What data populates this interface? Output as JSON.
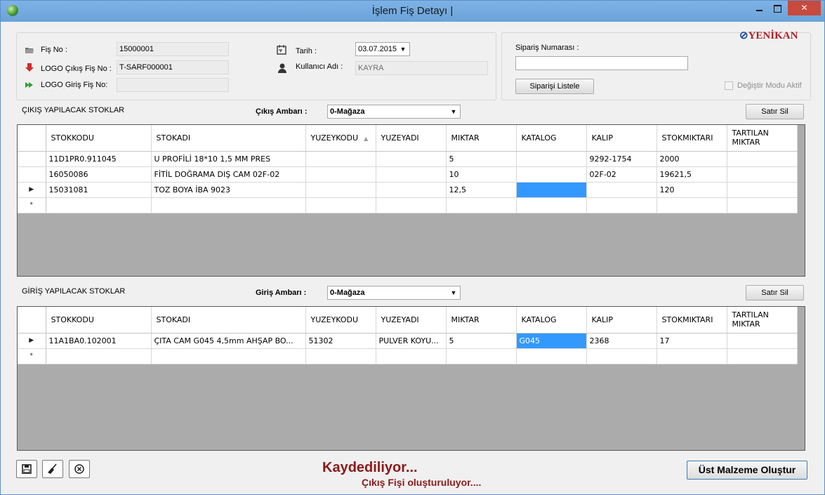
{
  "window": {
    "title": "İşlem Fiş Detayı |"
  },
  "header": {
    "fis_no_label": "Fiş No :",
    "fis_no_value": "15000001",
    "logo_cikis_label": "LOGO Çıkış Fiş No :",
    "logo_cikis_value": "T-SARF000001",
    "logo_giris_label": "LOGO Giriş Fiş No:",
    "logo_giris_value": "",
    "tarih_label": "Tarih :",
    "tarih_value": "03.07.2015",
    "kullanici_label": "Kullanıcı Adı :",
    "kullanici_value": "KAYRA"
  },
  "order": {
    "label": "Sipariş Numarası :",
    "input_value": "",
    "list_button": "Siparişi Listele",
    "logo_brand": "YENİKAN",
    "edit_mode_label": "Değiştir Modu Aktif"
  },
  "cikis": {
    "section_title": "ÇIKIŞ YAPILACAK STOKLAR",
    "ambar_label": "Çıkış Ambarı :",
    "ambar_value": "0-Mağaza",
    "delete_button": "Satır Sil",
    "columns": [
      "STOKKODU",
      "STOKADI",
      "YUZEYKODU",
      "YUZEYADI",
      "MIKTAR",
      "KATALOG",
      "KALIP",
      "STOKMIKTARI",
      "TARTILAN MIKTAR"
    ],
    "rows": [
      [
        "11D1PR0.911045",
        "U PROFİLİ 18*10 1,5 MM PRES",
        "",
        "",
        "5",
        "",
        "9292-1754",
        "2000",
        ""
      ],
      [
        "16050086",
        "FİTİL DOĞRAMA DIŞ CAM 02F-02",
        "",
        "",
        "10",
        "",
        "02F-02",
        "19621,5",
        ""
      ],
      [
        "15031081",
        "TOZ BOYA İBA 9023",
        "",
        "",
        "12,5",
        "",
        "",
        "120",
        ""
      ]
    ]
  },
  "giris": {
    "section_title": "GİRİŞ YAPILACAK STOKLAR",
    "ambar_label": "Giriş Ambarı :",
    "ambar_value": "0-Mağaza",
    "delete_button": "Satır Sil",
    "columns": [
      "STOKKODU",
      "STOKADI",
      "YUZEYKODU",
      "YUZEYADI",
      "MIKTAR",
      "KATALOG",
      "KALIP",
      "STOKMIKTARI",
      "TARTILAN MIKTAR"
    ],
    "rows": [
      [
        "11A1BA0.102001",
        "ÇITA CAM G045 4,5mm AHŞAP BO...",
        "51302",
        "PULVER KOYU...",
        "5",
        "G045",
        "2368",
        "17",
        ""
      ]
    ]
  },
  "footer": {
    "status_main": "Kaydediliyor...",
    "status_sub": "Çıkış Fişi oluşturuluyor....",
    "create_button": "Üst Malzeme Oluştur"
  },
  "colors": {
    "selection": "#3399ff",
    "status": "#8b1a1a",
    "close_button": "#c74a3d"
  }
}
